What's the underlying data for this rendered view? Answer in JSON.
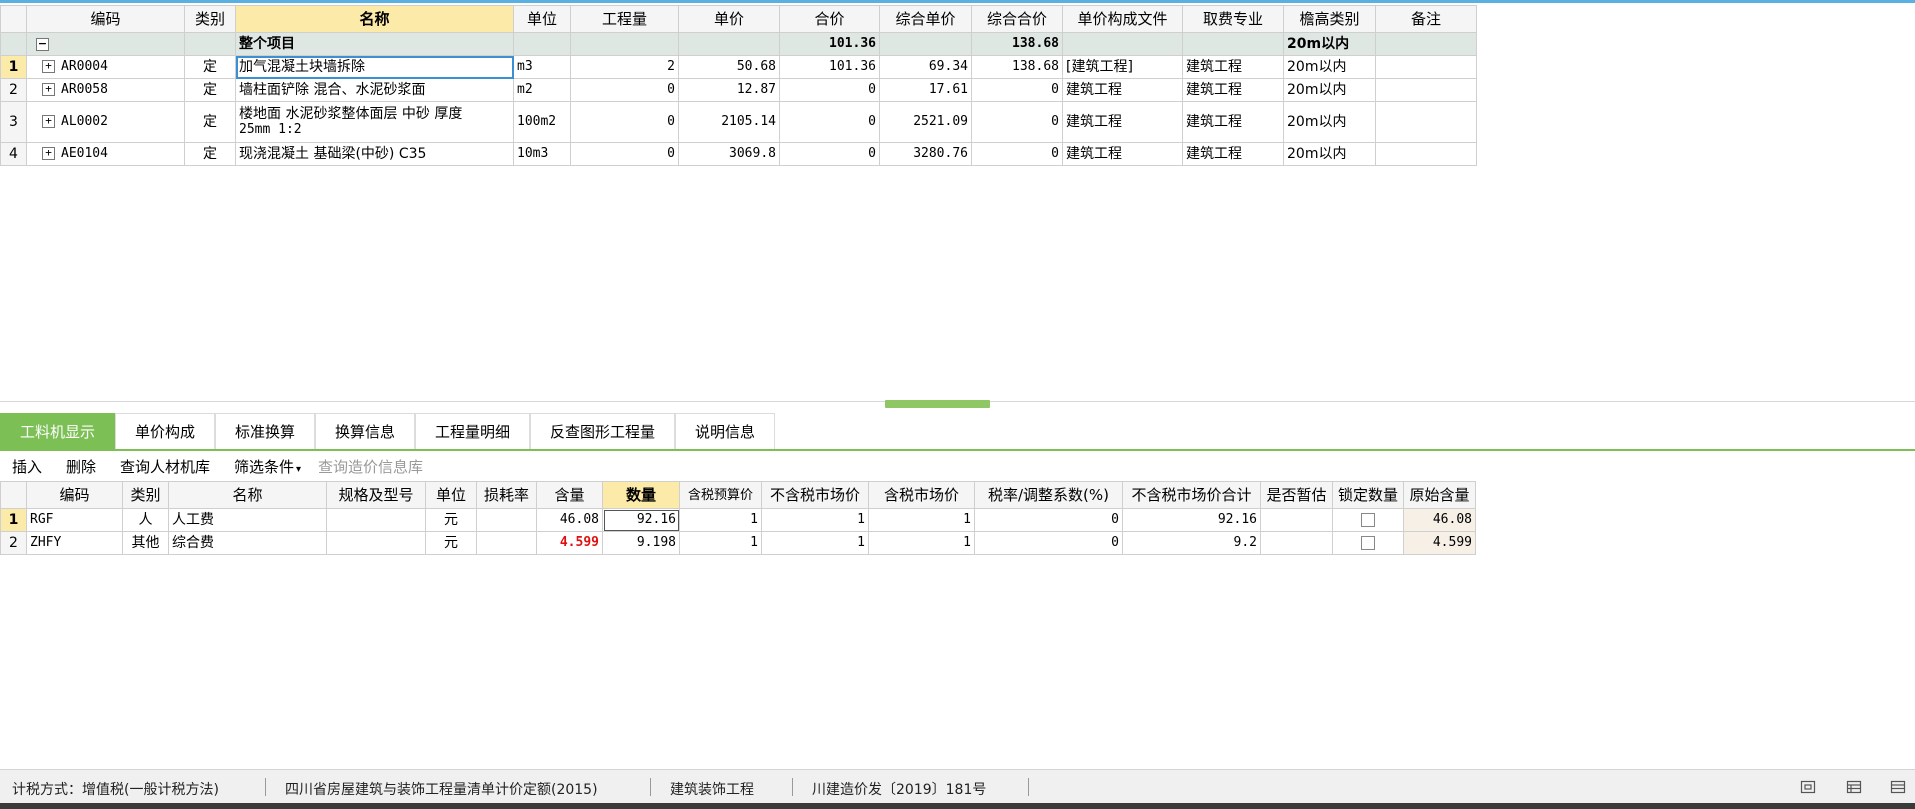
{
  "upper": {
    "headers": [
      "编码",
      "类别",
      "名称",
      "单位",
      "工程量",
      "单价",
      "合价",
      "综合单价",
      "综合合价",
      "单价构成文件",
      "取费专业",
      "檐高类别",
      "备注"
    ],
    "summary": {
      "name": "整个项目",
      "hejia": "101.36",
      "zonghe_hejia": "138.68",
      "yangao": "20m以内"
    },
    "rows": [
      {
        "rn": "1",
        "code": "AR0004",
        "type": "定",
        "name": "加气混凝土块墙拆除",
        "unit": "m3",
        "qty": "2",
        "price": "50.68",
        "total": "101.36",
        "zprice": "69.34",
        "ztotal": "138.68",
        "file": "[建筑工程]",
        "major": "建筑工程",
        "height": "20m以内",
        "note": ""
      },
      {
        "rn": "2",
        "code": "AR0058",
        "type": "定",
        "name": "墙柱面铲除 混合、水泥砂浆面",
        "unit": "m2",
        "qty": "0",
        "price": "12.87",
        "total": "0",
        "zprice": "17.61",
        "ztotal": "0",
        "file": "建筑工程",
        "major": "建筑工程",
        "height": "20m以内",
        "note": ""
      },
      {
        "rn": "3",
        "code": "AL0002",
        "type": "定",
        "name": "楼地面 水泥砂浆整体面层 中砂 厚度",
        "name2": "25mm 1:2",
        "unit": "100m2",
        "qty": "0",
        "price": "2105.14",
        "total": "0",
        "zprice": "2521.09",
        "ztotal": "0",
        "file": "建筑工程",
        "major": "建筑工程",
        "height": "20m以内",
        "note": ""
      },
      {
        "rn": "4",
        "code": "AE0104",
        "type": "定",
        "name": "现浇混凝土 基础梁(中砂) C35",
        "unit": "10m3",
        "qty": "0",
        "price": "3069.8",
        "total": "0",
        "zprice": "3280.76",
        "ztotal": "0",
        "file": "建筑工程",
        "major": "建筑工程",
        "height": "20m以内",
        "note": ""
      }
    ]
  },
  "tabs": [
    "工料机显示",
    "单价构成",
    "标准换算",
    "换算信息",
    "工程量明细",
    "反查图形工程量",
    "说明信息"
  ],
  "toolbar": {
    "insert": "插入",
    "delete": "删除",
    "query_lib": "查询人材机库",
    "filter": "筛选条件",
    "filter_arrow": "▾",
    "query_price": "查询造价信息库"
  },
  "lower": {
    "headers": [
      "编码",
      "类别",
      "名称",
      "规格及型号",
      "单位",
      "损耗率",
      "含量",
      "数量",
      "含税预算价",
      "不含税市场价",
      "含税市场价",
      "税率/调整系数(%)",
      "不含税市场价合计",
      "是否暂估",
      "锁定数量",
      "原始含量"
    ],
    "rows": [
      {
        "rn": "1",
        "code": "RGF",
        "type": "人",
        "name": "人工费",
        "spec": "",
        "unit": "元",
        "loss": "",
        "content": "46.08",
        "qty": "92.16",
        "tax_budget": "1",
        "mkt_notax": "1",
        "mkt_tax": "1",
        "rate": "0",
        "total_notax": "92.16",
        "est": "",
        "orig": "46.08"
      },
      {
        "rn": "2",
        "code": "ZHFY",
        "type": "其他",
        "name": "综合费",
        "spec": "",
        "unit": "元",
        "loss": "",
        "content": "4.599",
        "qty": "9.198",
        "tax_budget": "1",
        "mkt_notax": "1",
        "mkt_tax": "1",
        "rate": "0",
        "total_notax": "9.2",
        "est": "",
        "orig": "4.599"
      }
    ]
  },
  "status": {
    "tax": "计税方式：增值税(一般计税方法)",
    "quota": "四川省房屋建筑与装饰工程量清单计价定额(2015)",
    "major": "建筑装饰工程",
    "doc": "川建造价发〔2019〕181号"
  },
  "colors": {
    "accent_green": "#7bbf55",
    "header_highlight": "#fbeaa8",
    "summary_bg": "#dfe7e2",
    "selection_blue": "#3c8fd0",
    "red_value": "#e01010"
  }
}
